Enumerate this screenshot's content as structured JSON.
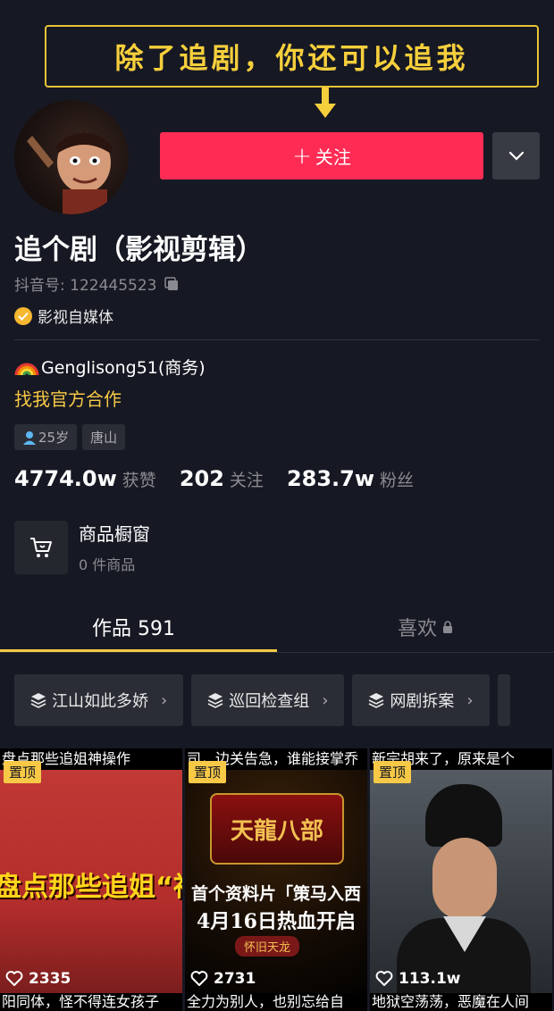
{
  "banner": {
    "text": "除了追剧，你还可以追我"
  },
  "profile": {
    "name": "追个剧（影视剪辑）",
    "douyin_id": "抖音号: 122445523",
    "verification": "影视自媒体",
    "bio_line1": "Genglisong51(商务)",
    "bio_line2": "找我官方合作",
    "tags": [
      "25岁",
      "唐山"
    ]
  },
  "actions": {
    "follow_label": "关注"
  },
  "stats": [
    {
      "value": "4774.0w",
      "label": "获赞"
    },
    {
      "value": "202",
      "label": "关注"
    },
    {
      "value": "283.7w",
      "label": "粉丝"
    }
  ],
  "shop": {
    "title": "商品橱窗",
    "subtitle": "0 件商品"
  },
  "tabs": {
    "works": "作品 591",
    "likes": "喜欢"
  },
  "collections": [
    "江山如此多娇",
    "巡回检查组",
    "网剧拆案"
  ],
  "videos": [
    {
      "top_caption": "盘点那些追姐神操作",
      "pinned": "置顶",
      "headline": "盘点那些追姐“神",
      "likes": "2335",
      "bottom_caption": "阳同体，怪不得连女孩子"
    },
    {
      "top_caption": "司，边关告急，谁能接掌乔",
      "pinned": "置顶",
      "logo": "天龍八部",
      "line1": "首个资料片「策马入西",
      "line2": "4月16日热血开启",
      "pill": "怀旧天龙",
      "likes": "2731",
      "bottom_caption": "全力为别人，也别忘给自"
    },
    {
      "top_caption": "新宗胡来了，原来是个",
      "pinned": "置顶",
      "likes": "113.1w",
      "bottom_caption": "地狱空荡荡，恶魔在人间"
    }
  ],
  "colors": {
    "accent_red": "#fe2c55",
    "accent_yellow": "#f7c946",
    "background": "#161823"
  }
}
